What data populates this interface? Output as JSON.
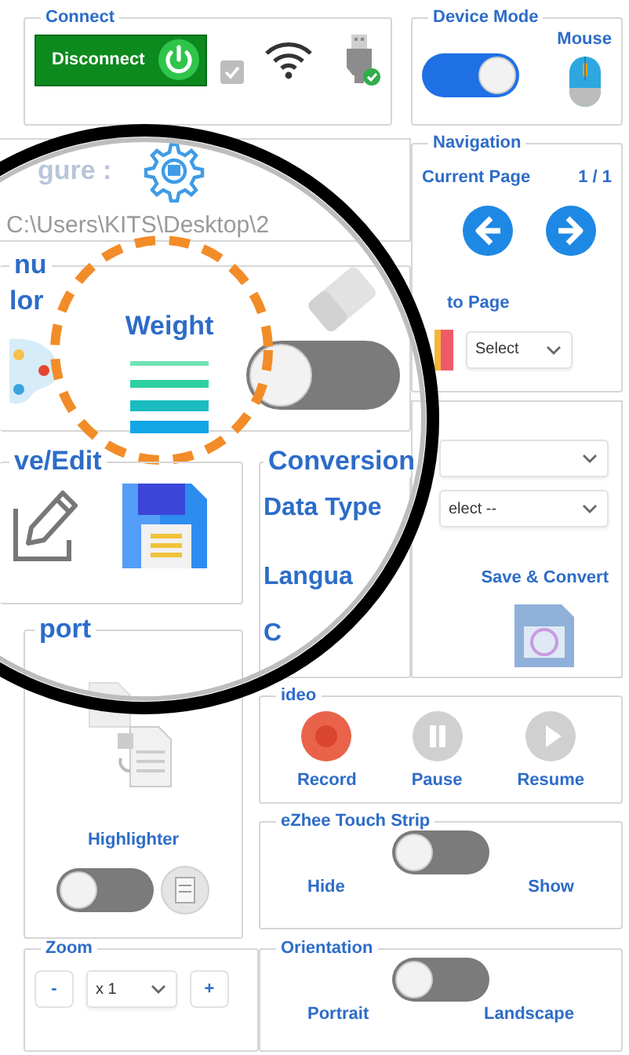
{
  "connect": {
    "title": "Connect",
    "button": "Disconnect",
    "checkbox": {
      "checked": true,
      "disabled": true
    },
    "usb": {
      "connected": true
    }
  },
  "device_mode": {
    "title": "Device Mode",
    "label": "Mouse",
    "toggle": {
      "on": true
    }
  },
  "figure": {
    "label": "gure :",
    "path": "C:\\Users\\KITS\\Desktop\\2"
  },
  "navigation": {
    "title": "Navigation",
    "current_page_label": "Current Page",
    "page_count": "1 / 1",
    "goto_label": "to Page",
    "select": "Select"
  },
  "menu": {
    "title": "nu",
    "items": [
      {
        "kind": "palette",
        "label": "lor"
      },
      {
        "kind": "lines",
        "label": "Weight",
        "highlighted": true
      },
      {
        "kind": "eraser",
        "toggle": {
          "on": false
        }
      }
    ]
  },
  "save_edit": {
    "title": "ve/Edit"
  },
  "conversion": {
    "title": "Conversion",
    "data_type_label": "Data Type",
    "language_label": "Langua",
    "cut_label": "C"
  },
  "conversion_side": {
    "data_type_value": "elect --",
    "save_convert_label": "Save & Convert"
  },
  "export": {
    "title": "port",
    "highlighter_label": "Highlighter",
    "highlighter_toggle": {
      "on": false
    }
  },
  "video": {
    "title": "ideo",
    "buttons": [
      {
        "kind": "record",
        "label": "Record",
        "active": true
      },
      {
        "kind": "pause",
        "label": "Pause",
        "active": false
      },
      {
        "kind": "resume",
        "label": "Resume",
        "active": false
      }
    ]
  },
  "touch_strip": {
    "title": "eZhee Touch Strip",
    "toggle": {
      "on": false
    },
    "off_label": "Hide",
    "on_label": "Show"
  },
  "zoom": {
    "title": "Zoom",
    "minus": "-",
    "value": "x 1",
    "plus": "+"
  },
  "orientation": {
    "title": "Orientation",
    "toggle": {
      "on": false
    },
    "off_label": "Portrait",
    "on_label": "Landscape"
  }
}
